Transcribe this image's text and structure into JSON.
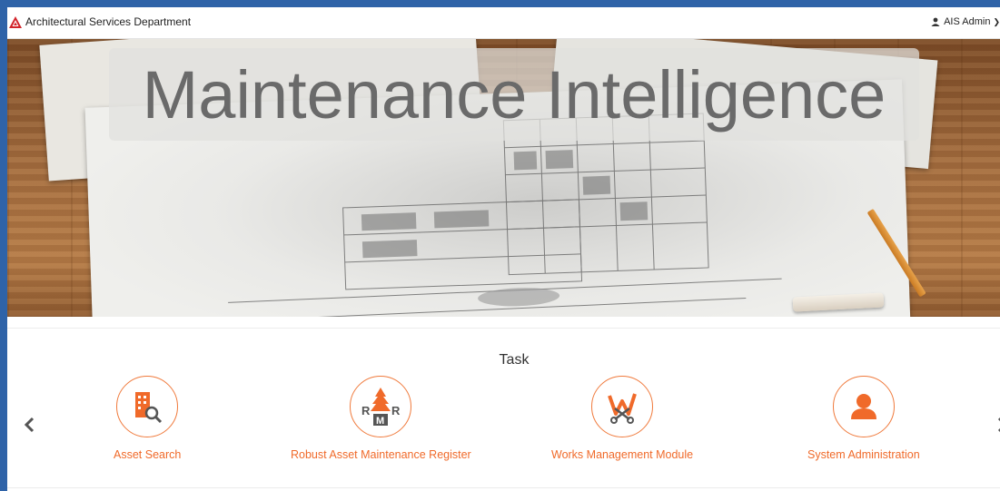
{
  "header": {
    "brand": "Architectural Services Department",
    "user": "AIS Admin",
    "logo_icon": "triangle-logo-icon",
    "user_icon": "user-icon",
    "caret_icon": "chevron-down-icon"
  },
  "hero": {
    "title": "Maintenance Intelligence"
  },
  "tasks": {
    "heading": "Task",
    "items": [
      {
        "label": "Asset Search",
        "icon": "building-search-icon"
      },
      {
        "label": "Robust Asset Maintenance Register",
        "icon": "ramr-logo-icon"
      },
      {
        "label": "Works Management Module",
        "icon": "works-tools-icon"
      },
      {
        "label": "System Administration",
        "icon": "admin-user-icon"
      }
    ],
    "prev_icon": "chevron-left-icon",
    "next_icon": "chevron-right-icon"
  },
  "colors": {
    "accent": "#f06a2a",
    "page_background": "#2f63a8",
    "brand_red": "#d2232a"
  }
}
